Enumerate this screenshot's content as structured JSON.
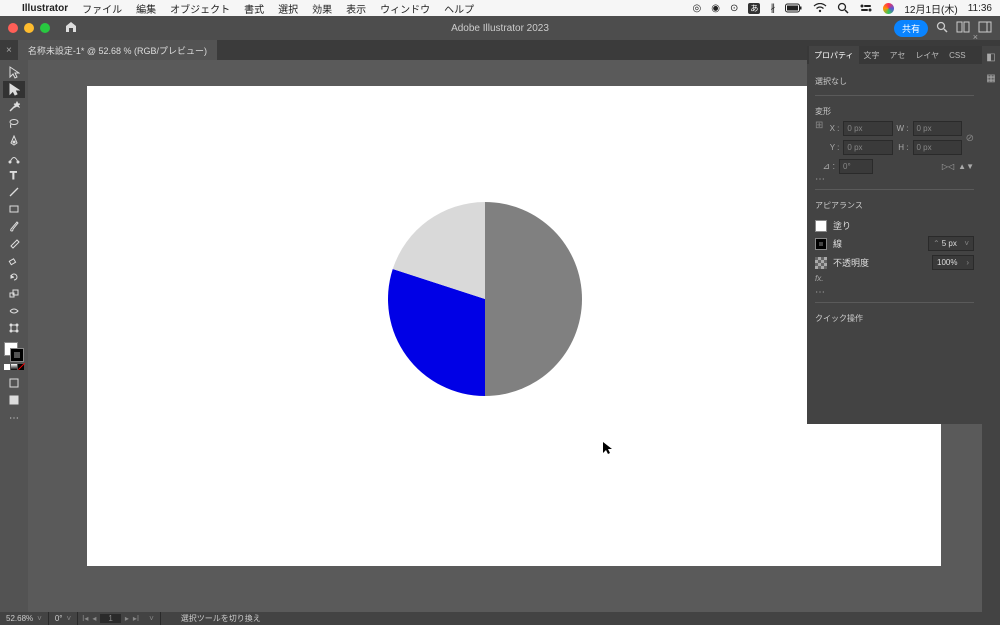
{
  "menubar": {
    "app": "Illustrator",
    "items": [
      "ファイル",
      "編集",
      "オブジェクト",
      "書式",
      "選択",
      "効果",
      "表示",
      "ウィンドウ",
      "ヘルプ"
    ],
    "date": "12月1日(木)",
    "time": "11:36"
  },
  "titlebar": {
    "title": "Adobe Illustrator 2023",
    "share": "共有"
  },
  "tab": {
    "label": "名称未設定-1* @ 52.68 % (RGB/プレビュー)"
  },
  "properties": {
    "tabs": [
      "プロパティ",
      "文字",
      "アセ",
      "レイヤ",
      "CSS"
    ],
    "noselection": "選択なし",
    "transform_heading": "変形",
    "xlabel": "X :",
    "ylabel": "Y :",
    "wlabel": "W :",
    "hlabel": "H :",
    "xval": "0 px",
    "yval": "0 px",
    "wval": "0 px",
    "hval": "0 px",
    "anglelabel": "⊿ :",
    "angleval": "0°",
    "appearance_heading": "アピアランス",
    "fill": "塗り",
    "stroke": "線",
    "stroke_weight": "5 px",
    "opacity_label": "不透明度",
    "opacity_val": "100%",
    "fx": "fx.",
    "quick_actions": "クイック操作"
  },
  "statusbar": {
    "zoom": "52.68%",
    "rotate": "0°",
    "artboard_num": "1",
    "hint": "選択ツールを切り換え"
  },
  "chart_data": {
    "type": "pie",
    "series": [
      {
        "name": "segment-gray",
        "value": 50,
        "color": "#808080"
      },
      {
        "name": "segment-blue",
        "value": 30,
        "color": "#0000e6"
      },
      {
        "name": "segment-lightgray",
        "value": 20,
        "color": "#d9d9d9"
      }
    ],
    "center": {
      "x": 400,
      "y": 213
    },
    "radius": 97,
    "start_angle_deg": -90
  }
}
